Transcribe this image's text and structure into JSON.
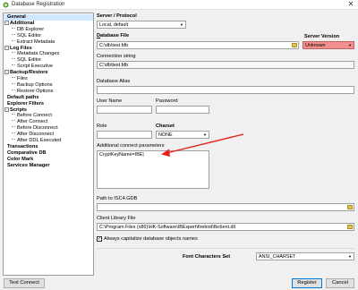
{
  "window": {
    "title": "Database Registration"
  },
  "tree": [
    {
      "label": "General",
      "level": 0,
      "selected": true
    },
    {
      "label": "Additional",
      "level": 0,
      "expanded": true
    },
    {
      "label": "DB Explorer",
      "level": 1
    },
    {
      "label": "SQL Editor",
      "level": 1
    },
    {
      "label": "Extract Metadata",
      "level": 1
    },
    {
      "label": "Log Files",
      "level": 0,
      "expanded": true
    },
    {
      "label": "Metadata Changes",
      "level": 1
    },
    {
      "label": "SQL Editor",
      "level": 1
    },
    {
      "label": "Script Executive",
      "level": 1
    },
    {
      "label": "Backup/Restore",
      "level": 0,
      "expanded": true
    },
    {
      "label": "Files",
      "level": 1
    },
    {
      "label": "Backup Options",
      "level": 1
    },
    {
      "label": "Restore Options",
      "level": 1
    },
    {
      "label": "Default paths",
      "level": 0
    },
    {
      "label": "Explorer Filters",
      "level": 0
    },
    {
      "label": "Scripts",
      "level": 0,
      "expanded": true
    },
    {
      "label": "Before Connect",
      "level": 1
    },
    {
      "label": "After Connect",
      "level": 1
    },
    {
      "label": "Before Disconnect",
      "level": 1
    },
    {
      "label": "After Disconnect",
      "level": 1
    },
    {
      "label": "After DDL Executed",
      "level": 1
    },
    {
      "label": "Transactions",
      "level": 0
    },
    {
      "label": "Comparative DB",
      "level": 0
    },
    {
      "label": "Color Mark",
      "level": 0
    },
    {
      "label": "Services Manager",
      "level": 0
    }
  ],
  "form": {
    "server_protocol_label": "Server / Protocol",
    "server_protocol_value": "Local, default",
    "database_file_label": "Database File",
    "database_file_value": "C:\\db\\test.fdb",
    "server_version_label": "Server Version",
    "server_version_value": "Unknown",
    "connection_string_label": "Connection string",
    "connection_string_value": "C:\\db\\test.fdb",
    "database_alias_label": "Database Alias",
    "database_alias_value": "",
    "user_name_label": "User Name",
    "user_name_value": "",
    "password_label": "Password",
    "password_value": "",
    "role_label": "Role",
    "role_value": "",
    "charset_label": "Charset",
    "charset_value": "NONE",
    "additional_params_label": "Additional connect parameters",
    "additional_params_value": "CryptKeyName=IBE|",
    "isc4_label": "Path to ISC4.GDB",
    "isc4_value": "",
    "client_lib_label": "Client Library File",
    "client_lib_value": "C:\\Program Files (x86)\\HK-Software\\IBExpert\\firebird\\fbclient.dll",
    "capitalize_label": "Always capitalize database objects names",
    "capitalize_checked": true,
    "font_charset_label": "Font Characters Set",
    "font_charset_value": "ANSI_CHARSET"
  },
  "buttons": {
    "test_connect": "Test Connect",
    "register": "Register",
    "cancel": "Cancel"
  },
  "colors": {
    "server_version_bg": "#f48f8f",
    "arrow": "#e8201a",
    "selection": "#cfe8ff"
  }
}
